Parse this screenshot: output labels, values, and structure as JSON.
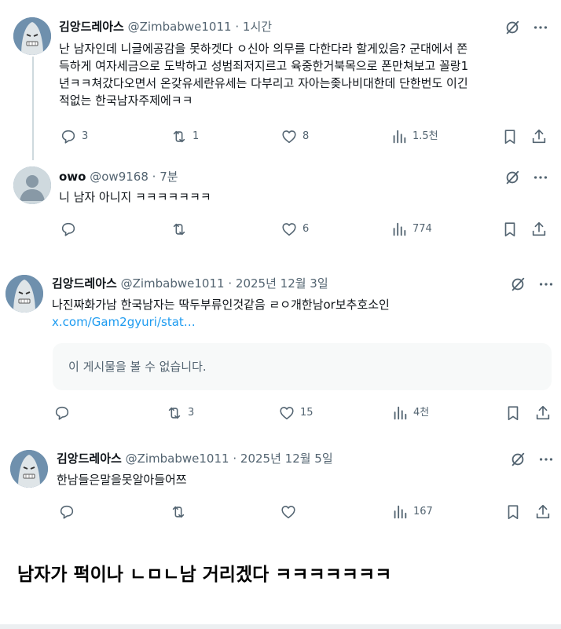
{
  "tweets": [
    {
      "name": "김앙드레아스",
      "handle": "@Zimbabwe1011",
      "sep": "·",
      "time": "1시간",
      "lines": [
        "난 남자인데 니글에공감을 못하겟다 ㅇ신아 의무를 다한다라 할게있음? 군대에서 쫀",
        "득하게 여자세금으로 도박하고 성범죄저지르고 육중한거북목으로 폰만쳐보고 꼴랑1",
        "년ㅋㅋ쳐갔다오면서 온갖유세란유세는 다부리고 자아는좆나비대한데 단한번도 이긴",
        "적없는 한국남자주제에ㅋㅋ"
      ],
      "replies": "3",
      "reposts": "1",
      "likes": "8",
      "views": "1.5천"
    },
    {
      "name": "owo",
      "handle": "@ow9168",
      "sep": "·",
      "time": "7분",
      "lines": [
        "니 남자 아니지 ㅋㅋㅋㅋㅋㅋㅋ"
      ],
      "replies": "",
      "reposts": "",
      "likes": "6",
      "views": "774"
    },
    {
      "name": "김앙드레아스",
      "handle": "@Zimbabwe1011",
      "sep": "·",
      "time": "2025년 12월 3일",
      "lines": [
        "나진짜화가남 한국남자는 딱두부류인것같음 ㄹㅇ개한남or보추호소인"
      ],
      "link": "x.com/Gam2gyuri/stat…",
      "embed": "이 게시물을 볼 수 없습니다.",
      "replies": "",
      "reposts": "3",
      "likes": "15",
      "views": "4천"
    },
    {
      "name": "김앙드레아스",
      "handle": "@Zimbabwe1011",
      "sep": "·",
      "time": "2025년 12월 5일",
      "lines": [
        "한남들은말을못알아들어쯔"
      ],
      "replies": "",
      "reposts": "",
      "likes": "",
      "views": "167"
    }
  ],
  "caption": "남자가 퍽이나 ㄴㅁㄴ남 거리겠다 ㅋㅋㅋㅋㅋㅋㅋ",
  "icons": [
    "grok-icon",
    "more-icon",
    "reply-icon",
    "repost-icon",
    "like-icon",
    "views-icon",
    "bookmark-icon",
    "share-icon"
  ],
  "colors": {
    "text": "#0f1419",
    "secondary": "#536471",
    "link": "#1d9bf0",
    "embed_bg": "#f7f9f9",
    "avatar": "#6f90ad"
  }
}
